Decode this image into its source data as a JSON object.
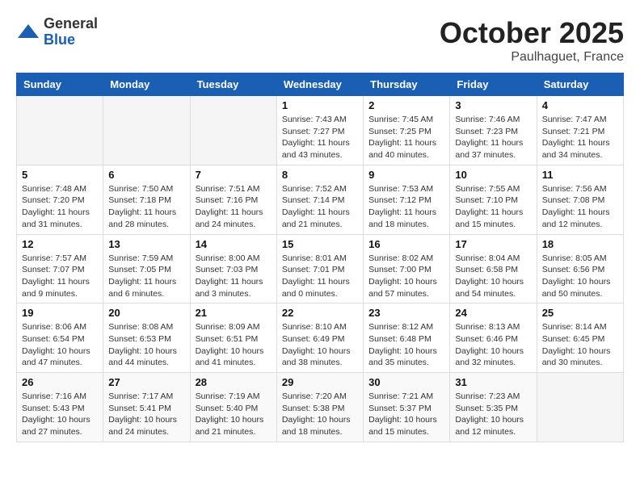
{
  "header": {
    "logo_general": "General",
    "logo_blue": "Blue",
    "month_title": "October 2025",
    "location": "Paulhaguet, France"
  },
  "days_of_week": [
    "Sunday",
    "Monday",
    "Tuesday",
    "Wednesday",
    "Thursday",
    "Friday",
    "Saturday"
  ],
  "weeks": [
    [
      {
        "day": "",
        "info": ""
      },
      {
        "day": "",
        "info": ""
      },
      {
        "day": "",
        "info": ""
      },
      {
        "day": "1",
        "info": "Sunrise: 7:43 AM\nSunset: 7:27 PM\nDaylight: 11 hours\nand 43 minutes."
      },
      {
        "day": "2",
        "info": "Sunrise: 7:45 AM\nSunset: 7:25 PM\nDaylight: 11 hours\nand 40 minutes."
      },
      {
        "day": "3",
        "info": "Sunrise: 7:46 AM\nSunset: 7:23 PM\nDaylight: 11 hours\nand 37 minutes."
      },
      {
        "day": "4",
        "info": "Sunrise: 7:47 AM\nSunset: 7:21 PM\nDaylight: 11 hours\nand 34 minutes."
      }
    ],
    [
      {
        "day": "5",
        "info": "Sunrise: 7:48 AM\nSunset: 7:20 PM\nDaylight: 11 hours\nand 31 minutes."
      },
      {
        "day": "6",
        "info": "Sunrise: 7:50 AM\nSunset: 7:18 PM\nDaylight: 11 hours\nand 28 minutes."
      },
      {
        "day": "7",
        "info": "Sunrise: 7:51 AM\nSunset: 7:16 PM\nDaylight: 11 hours\nand 24 minutes."
      },
      {
        "day": "8",
        "info": "Sunrise: 7:52 AM\nSunset: 7:14 PM\nDaylight: 11 hours\nand 21 minutes."
      },
      {
        "day": "9",
        "info": "Sunrise: 7:53 AM\nSunset: 7:12 PM\nDaylight: 11 hours\nand 18 minutes."
      },
      {
        "day": "10",
        "info": "Sunrise: 7:55 AM\nSunset: 7:10 PM\nDaylight: 11 hours\nand 15 minutes."
      },
      {
        "day": "11",
        "info": "Sunrise: 7:56 AM\nSunset: 7:08 PM\nDaylight: 11 hours\nand 12 minutes."
      }
    ],
    [
      {
        "day": "12",
        "info": "Sunrise: 7:57 AM\nSunset: 7:07 PM\nDaylight: 11 hours\nand 9 minutes."
      },
      {
        "day": "13",
        "info": "Sunrise: 7:59 AM\nSunset: 7:05 PM\nDaylight: 11 hours\nand 6 minutes."
      },
      {
        "day": "14",
        "info": "Sunrise: 8:00 AM\nSunset: 7:03 PM\nDaylight: 11 hours\nand 3 minutes."
      },
      {
        "day": "15",
        "info": "Sunrise: 8:01 AM\nSunset: 7:01 PM\nDaylight: 11 hours\nand 0 minutes."
      },
      {
        "day": "16",
        "info": "Sunrise: 8:02 AM\nSunset: 7:00 PM\nDaylight: 10 hours\nand 57 minutes."
      },
      {
        "day": "17",
        "info": "Sunrise: 8:04 AM\nSunset: 6:58 PM\nDaylight: 10 hours\nand 54 minutes."
      },
      {
        "day": "18",
        "info": "Sunrise: 8:05 AM\nSunset: 6:56 PM\nDaylight: 10 hours\nand 50 minutes."
      }
    ],
    [
      {
        "day": "19",
        "info": "Sunrise: 8:06 AM\nSunset: 6:54 PM\nDaylight: 10 hours\nand 47 minutes."
      },
      {
        "day": "20",
        "info": "Sunrise: 8:08 AM\nSunset: 6:53 PM\nDaylight: 10 hours\nand 44 minutes."
      },
      {
        "day": "21",
        "info": "Sunrise: 8:09 AM\nSunset: 6:51 PM\nDaylight: 10 hours\nand 41 minutes."
      },
      {
        "day": "22",
        "info": "Sunrise: 8:10 AM\nSunset: 6:49 PM\nDaylight: 10 hours\nand 38 minutes."
      },
      {
        "day": "23",
        "info": "Sunrise: 8:12 AM\nSunset: 6:48 PM\nDaylight: 10 hours\nand 35 minutes."
      },
      {
        "day": "24",
        "info": "Sunrise: 8:13 AM\nSunset: 6:46 PM\nDaylight: 10 hours\nand 32 minutes."
      },
      {
        "day": "25",
        "info": "Sunrise: 8:14 AM\nSunset: 6:45 PM\nDaylight: 10 hours\nand 30 minutes."
      }
    ],
    [
      {
        "day": "26",
        "info": "Sunrise: 7:16 AM\nSunset: 5:43 PM\nDaylight: 10 hours\nand 27 minutes."
      },
      {
        "day": "27",
        "info": "Sunrise: 7:17 AM\nSunset: 5:41 PM\nDaylight: 10 hours\nand 24 minutes."
      },
      {
        "day": "28",
        "info": "Sunrise: 7:19 AM\nSunset: 5:40 PM\nDaylight: 10 hours\nand 21 minutes."
      },
      {
        "day": "29",
        "info": "Sunrise: 7:20 AM\nSunset: 5:38 PM\nDaylight: 10 hours\nand 18 minutes."
      },
      {
        "day": "30",
        "info": "Sunrise: 7:21 AM\nSunset: 5:37 PM\nDaylight: 10 hours\nand 15 minutes."
      },
      {
        "day": "31",
        "info": "Sunrise: 7:23 AM\nSunset: 5:35 PM\nDaylight: 10 hours\nand 12 minutes."
      },
      {
        "day": "",
        "info": ""
      }
    ]
  ]
}
